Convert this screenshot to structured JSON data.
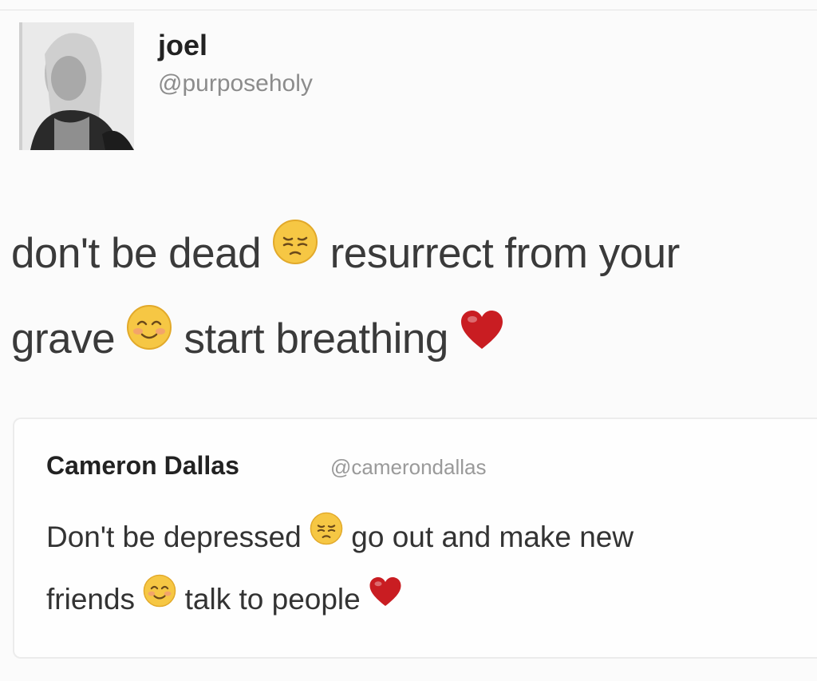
{
  "tweet": {
    "author_name": "joel",
    "author_handle": "@purposeholy",
    "line1_a": "don't be dead",
    "line1_b": "resurrect from your",
    "line2_a": "grave",
    "line2_b": "start breathing",
    "emojis": [
      "pensive-face",
      "smiling-face",
      "red-heart"
    ]
  },
  "quoted_tweet": {
    "author_name": "Cameron Dallas",
    "author_handle": "@camerondallas",
    "line1_a": "Don't be depressed",
    "line1_b": "go out and make new",
    "line2_a": "friends",
    "line2_b": "talk to people",
    "emojis": [
      "pensive-face",
      "smiling-face",
      "red-heart"
    ]
  },
  "colors": {
    "emoji_yellow": "#f6c744",
    "heart_red": "#c91d22"
  }
}
